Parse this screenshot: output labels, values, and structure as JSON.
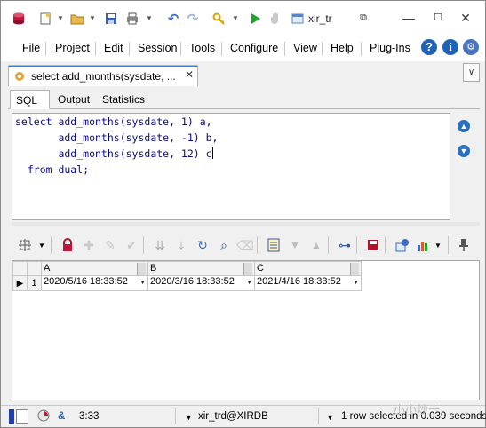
{
  "title_bar": {
    "title": "xir_tr...",
    "title_full_visible": "xir_tr"
  },
  "menu": {
    "items": [
      "File",
      "Project",
      "Edit",
      "Session",
      "Tools",
      "Configure",
      "View",
      "Help",
      "Plug-Ins"
    ]
  },
  "document_tab": {
    "label": "select add_months(sysdate, ..."
  },
  "sub_tabs": [
    "SQL",
    "Output",
    "Statistics"
  ],
  "sql_lines": [
    "select add_months(sysdate, 1) a,",
    "       add_months(sysdate, -1) b,",
    "       add_months(sysdate, 12) c",
    "  from dual;"
  ],
  "results": {
    "columns": [
      "A",
      "B",
      "C"
    ],
    "rows": [
      {
        "num": "1",
        "cells": [
          "2020/5/16 18:33:52",
          "2020/3/16 18:33:52",
          "2021/4/16 18:33:52"
        ]
      }
    ]
  },
  "status": {
    "position": "3:33",
    "connection": "xir_trd@XIRDB",
    "message": "1 row selected in 0.039 seconds"
  },
  "watermark": "小小炒十",
  "colors": {
    "accent": "#3a7bd5",
    "code": "#0a0a8a",
    "nav_button": "#2a6fc0"
  }
}
